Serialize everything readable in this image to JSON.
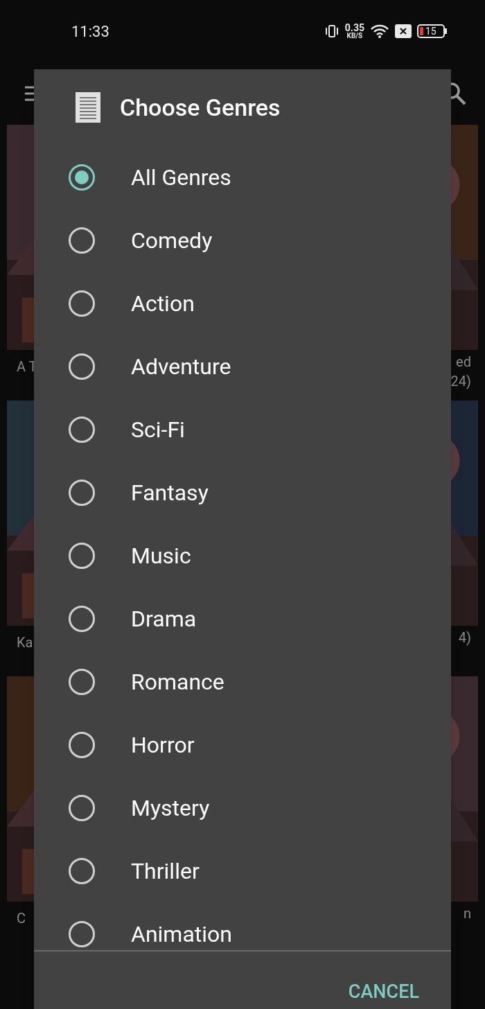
{
  "status_bar": {
    "time": "11:33",
    "speed_value": "0.35",
    "speed_unit": "KB/S",
    "battery": "15"
  },
  "grid": {
    "rows": [
      {
        "left_title": [
          "A T"
        ],
        "right_title": [
          "ed",
          "24)"
        ]
      },
      {
        "left_title": [
          "Ka"
        ],
        "right_title": [
          "4)"
        ]
      },
      {
        "left_title": [
          "C"
        ],
        "right_title": [
          "n"
        ]
      }
    ]
  },
  "dialog": {
    "title": "Choose Genres",
    "options": [
      {
        "label": "All Genres",
        "selected": true
      },
      {
        "label": "Comedy",
        "selected": false
      },
      {
        "label": "Action",
        "selected": false
      },
      {
        "label": "Adventure",
        "selected": false
      },
      {
        "label": "Sci-Fi",
        "selected": false
      },
      {
        "label": "Fantasy",
        "selected": false
      },
      {
        "label": "Music",
        "selected": false
      },
      {
        "label": "Drama",
        "selected": false
      },
      {
        "label": "Romance",
        "selected": false
      },
      {
        "label": "Horror",
        "selected": false
      },
      {
        "label": "Mystery",
        "selected": false
      },
      {
        "label": "Thriller",
        "selected": false
      },
      {
        "label": "Animation",
        "selected": false
      }
    ],
    "button": "CANCEL"
  }
}
